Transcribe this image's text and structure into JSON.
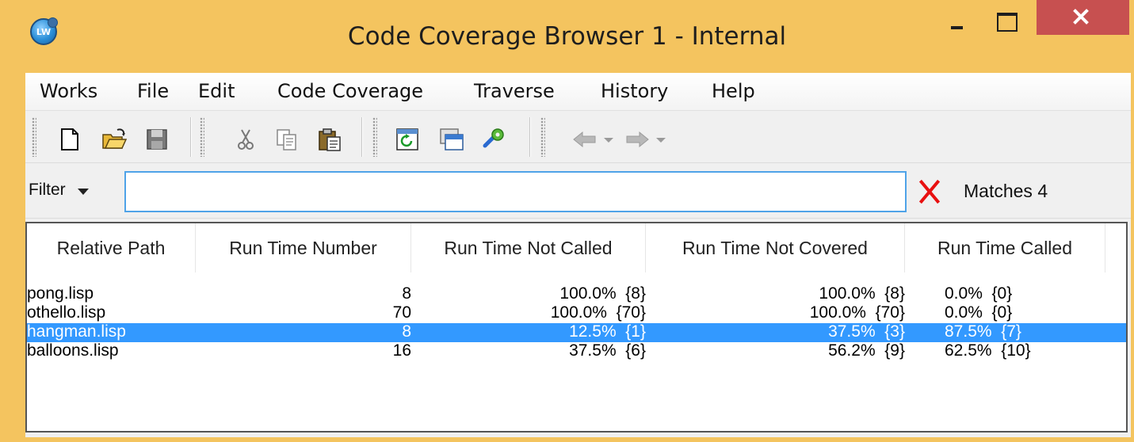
{
  "window": {
    "title": "Code Coverage Browser 1 - Internal",
    "icon_text": "LW"
  },
  "menu": [
    "Works",
    "File",
    "Edit",
    "Code Coverage",
    "Traverse",
    "History",
    "Help"
  ],
  "toolbar": {
    "icons": [
      "new-file-icon",
      "open-folder-icon",
      "save-icon",
      "cut-icon",
      "copy-icon",
      "paste-icon",
      "refresh-icon",
      "browse-window-icon",
      "tool-icon",
      "back-arrow-icon",
      "forward-arrow-icon"
    ]
  },
  "filter": {
    "label": "Filter",
    "value": "",
    "matches_text": "Matches 4"
  },
  "table": {
    "columns": [
      "Relative Path",
      "Run Time Number",
      "Run Time Not Called",
      "Run Time Not Covered",
      "Run Time Called"
    ],
    "rows": [
      {
        "path": "pong.lisp",
        "number": "8",
        "not_called": "100.0%  {8}",
        "not_covered": "100.0%  {8}",
        "called": "0.0%  {0}",
        "selected": false
      },
      {
        "path": "othello.lisp",
        "number": "70",
        "not_called": "100.0%  {70}",
        "not_covered": "100.0%  {70}",
        "called": "0.0%  {0}",
        "selected": false
      },
      {
        "path": "hangman.lisp",
        "number": "8",
        "not_called": "12.5%  {1}",
        "not_covered": "37.5%  {3}",
        "called": "87.5%  {7}",
        "selected": true
      },
      {
        "path": "balloons.lisp",
        "number": "16",
        "not_called": "37.5%  {6}",
        "not_covered": "56.2%  {9}",
        "called": "62.5%  {10}",
        "selected": false
      }
    ]
  },
  "colors": {
    "title_bar": "#f4c45f",
    "close_button": "#c75050",
    "selection": "#3399ff",
    "clear_x": "#e81010"
  }
}
